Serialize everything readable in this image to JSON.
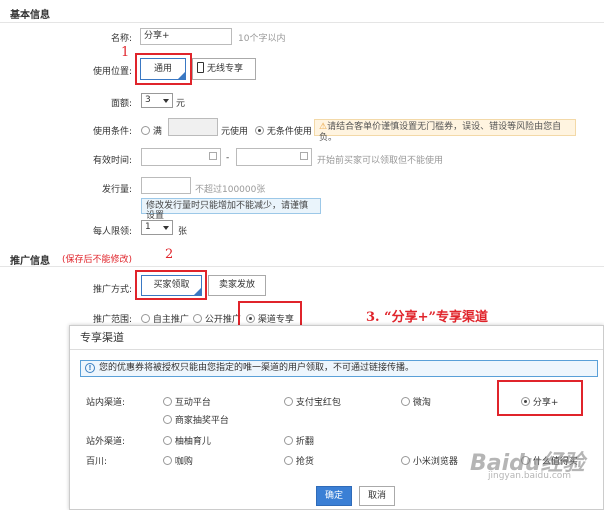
{
  "basic": {
    "title": "基本信息",
    "name_label": "名称:",
    "name_value": "分享+",
    "name_hint": "10个字以内",
    "position_label": "使用位置:",
    "position_tab1": "通用",
    "position_tab2": "无线专享",
    "amount_label": "面额:",
    "amount_value": "3",
    "amount_unit": "元",
    "cond_label": "使用条件:",
    "cond_opt1": "满",
    "cond_unit": "元使用",
    "cond_opt2": "无条件使用",
    "cond_warn": "请结合客单价谨慎设置无门槛券，误设、错设等风险由您自负。",
    "valid_label": "有效时间:",
    "valid_sep": "-",
    "valid_hint": "开始前买家可以领取但不能使用",
    "issue_label": "发行量:",
    "issue_hint": "不超过100000张",
    "issue_tip": "修改发行量时只能增加不能减少，请谨慎设置",
    "limit_label": "每人限领:",
    "limit_value": "1",
    "limit_unit": "张"
  },
  "promo": {
    "title": "推广信息",
    "note": "(保存后不能修改)",
    "method_label": "推广方式:",
    "method_tab1": "买家领取",
    "method_tab2": "卖家发放",
    "scope_label": "推广范围:",
    "scope_opt1": "自主推广",
    "scope_opt2": "公开推广",
    "scope_opt3": "渠道专享"
  },
  "annotations": {
    "num1": "1",
    "num2": "2",
    "num3": "3. “分享+”专享渠道"
  },
  "modal": {
    "title": "专享渠道",
    "info": "您的优惠券将被授权只能由您指定的唯一渠道的用户领取，不可通过链接传播。",
    "row1_label": "站内渠道:",
    "row1_opts": [
      "互动平台",
      "支付宝红包",
      "微淘",
      "分享+"
    ],
    "row1b_opts": [
      "商家抽奖平台"
    ],
    "row2_label": "站外渠道:",
    "row2_opts": [
      "柚柚育儿",
      "折翻"
    ],
    "row3_label": "百川:",
    "row3_opts": [
      "咖购",
      "抢货",
      "小米浏览器",
      "什么值得买"
    ],
    "ok": "确定",
    "cancel": "取消"
  },
  "watermark": {
    "logo": "Baidu经验",
    "url": "jingyan.baidu.com"
  },
  "colors": {
    "accent": "#3a78c3",
    "annotation_red": "#e0242b",
    "primary_button": "#3a7fd5"
  }
}
